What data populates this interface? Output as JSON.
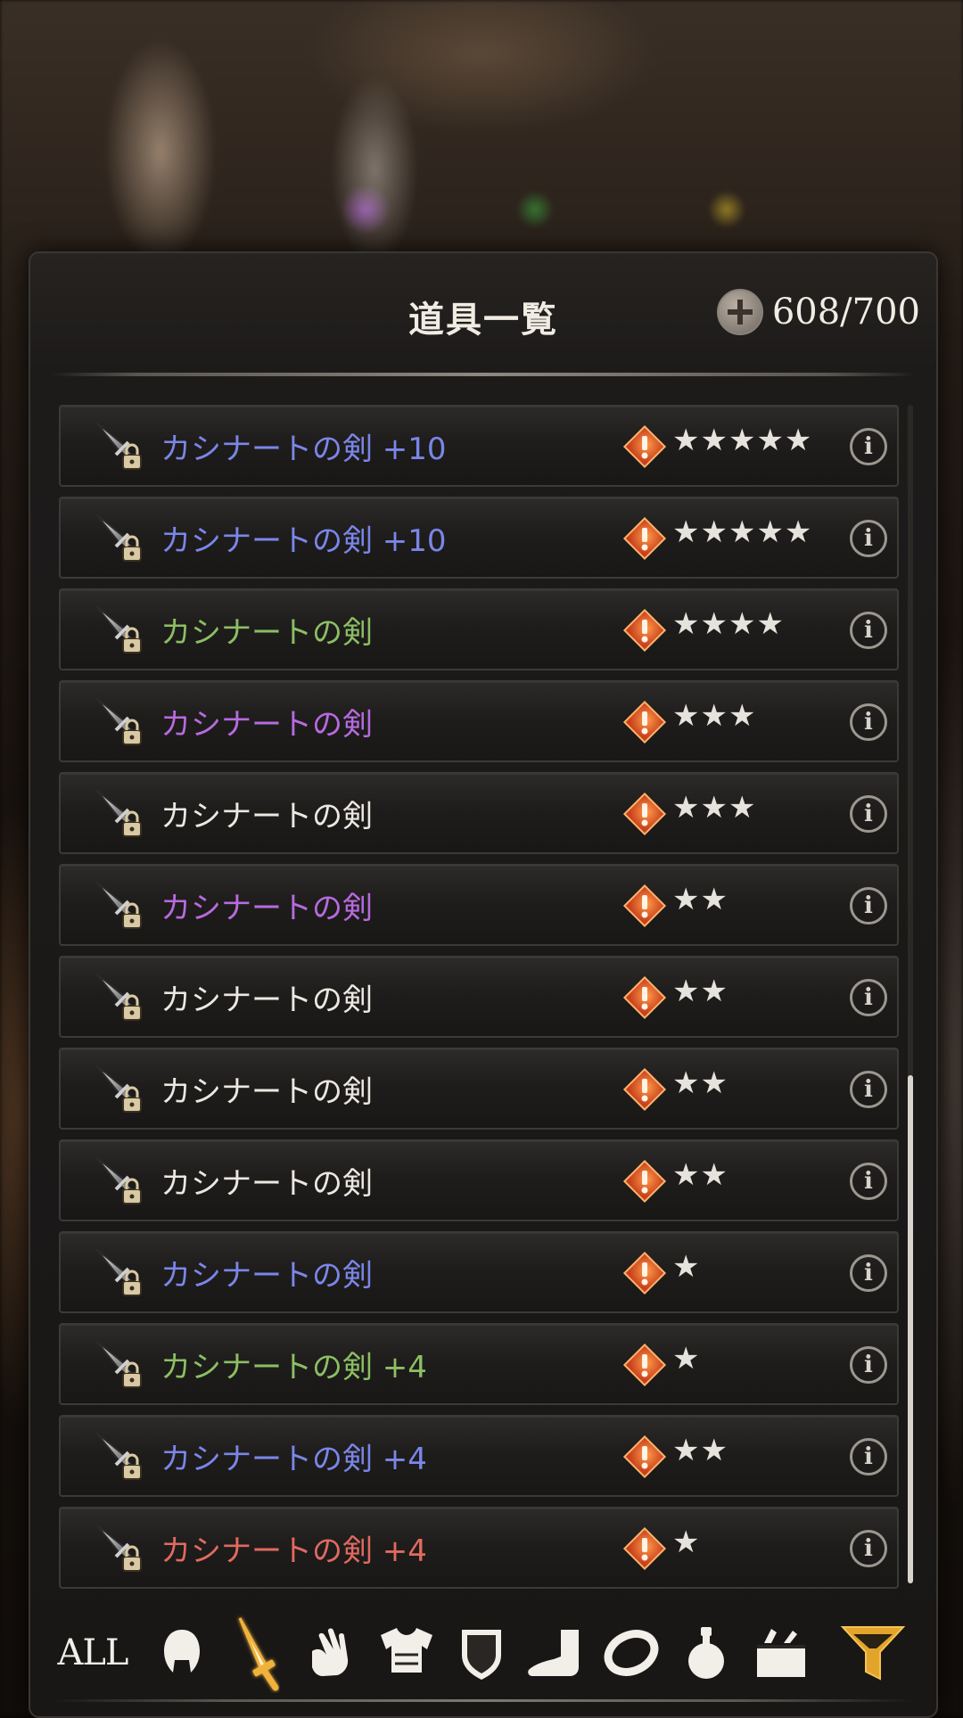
{
  "header": {
    "title": "道具一覧",
    "capacity": "608/700",
    "add_icon": "plus-circle-icon"
  },
  "items": [
    {
      "name": "カシナートの剣 +10",
      "color": "#7b86e8",
      "stars": "★★★★★"
    },
    {
      "name": "カシナートの剣 +10",
      "color": "#7b86e8",
      "stars": "★★★★★"
    },
    {
      "name": "カシナートの剣",
      "color": "#8cbf63",
      "stars": "★★★★"
    },
    {
      "name": "カシナートの剣",
      "color": "#b86ae0",
      "stars": "★★★"
    },
    {
      "name": "カシナートの剣",
      "color": "#ece8e1",
      "stars": "★★★"
    },
    {
      "name": "カシナートの剣",
      "color": "#b86ae0",
      "stars": "★★"
    },
    {
      "name": "カシナートの剣",
      "color": "#ece8e1",
      "stars": "★★"
    },
    {
      "name": "カシナートの剣",
      "color": "#ece8e1",
      "stars": "★★"
    },
    {
      "name": "カシナートの剣",
      "color": "#ece8e1",
      "stars": "★★"
    },
    {
      "name": "カシナートの剣",
      "color": "#7b86e8",
      "stars": "★"
    },
    {
      "name": "カシナートの剣 +4",
      "color": "#8cbf63",
      "stars": "★"
    },
    {
      "name": "カシナートの剣 +4",
      "color": "#7b86e8",
      "stars": "★★"
    },
    {
      "name": "カシナートの剣 +4",
      "color": "#e06a5f",
      "stars": "★"
    }
  ],
  "row_icons": {
    "weapon": "sword-lock-icon",
    "alert": "alert-diamond-icon",
    "info": "info-icon",
    "info_glyph": "i"
  },
  "filters": [
    {
      "label": "ALL",
      "icon": "all-text"
    },
    {
      "icon": "helmet-icon"
    },
    {
      "icon": "sword-icon",
      "selected": true
    },
    {
      "icon": "gloves-icon"
    },
    {
      "icon": "armor-icon"
    },
    {
      "icon": "shield-icon"
    },
    {
      "icon": "boots-icon"
    },
    {
      "icon": "ring-icon"
    },
    {
      "icon": "potion-icon"
    },
    {
      "icon": "item-box-icon"
    },
    {
      "icon": "filter-funnel-icon"
    }
  ],
  "colors": {
    "accent_gold": "#f0b23a",
    "alert_orange": "#e8702a"
  }
}
